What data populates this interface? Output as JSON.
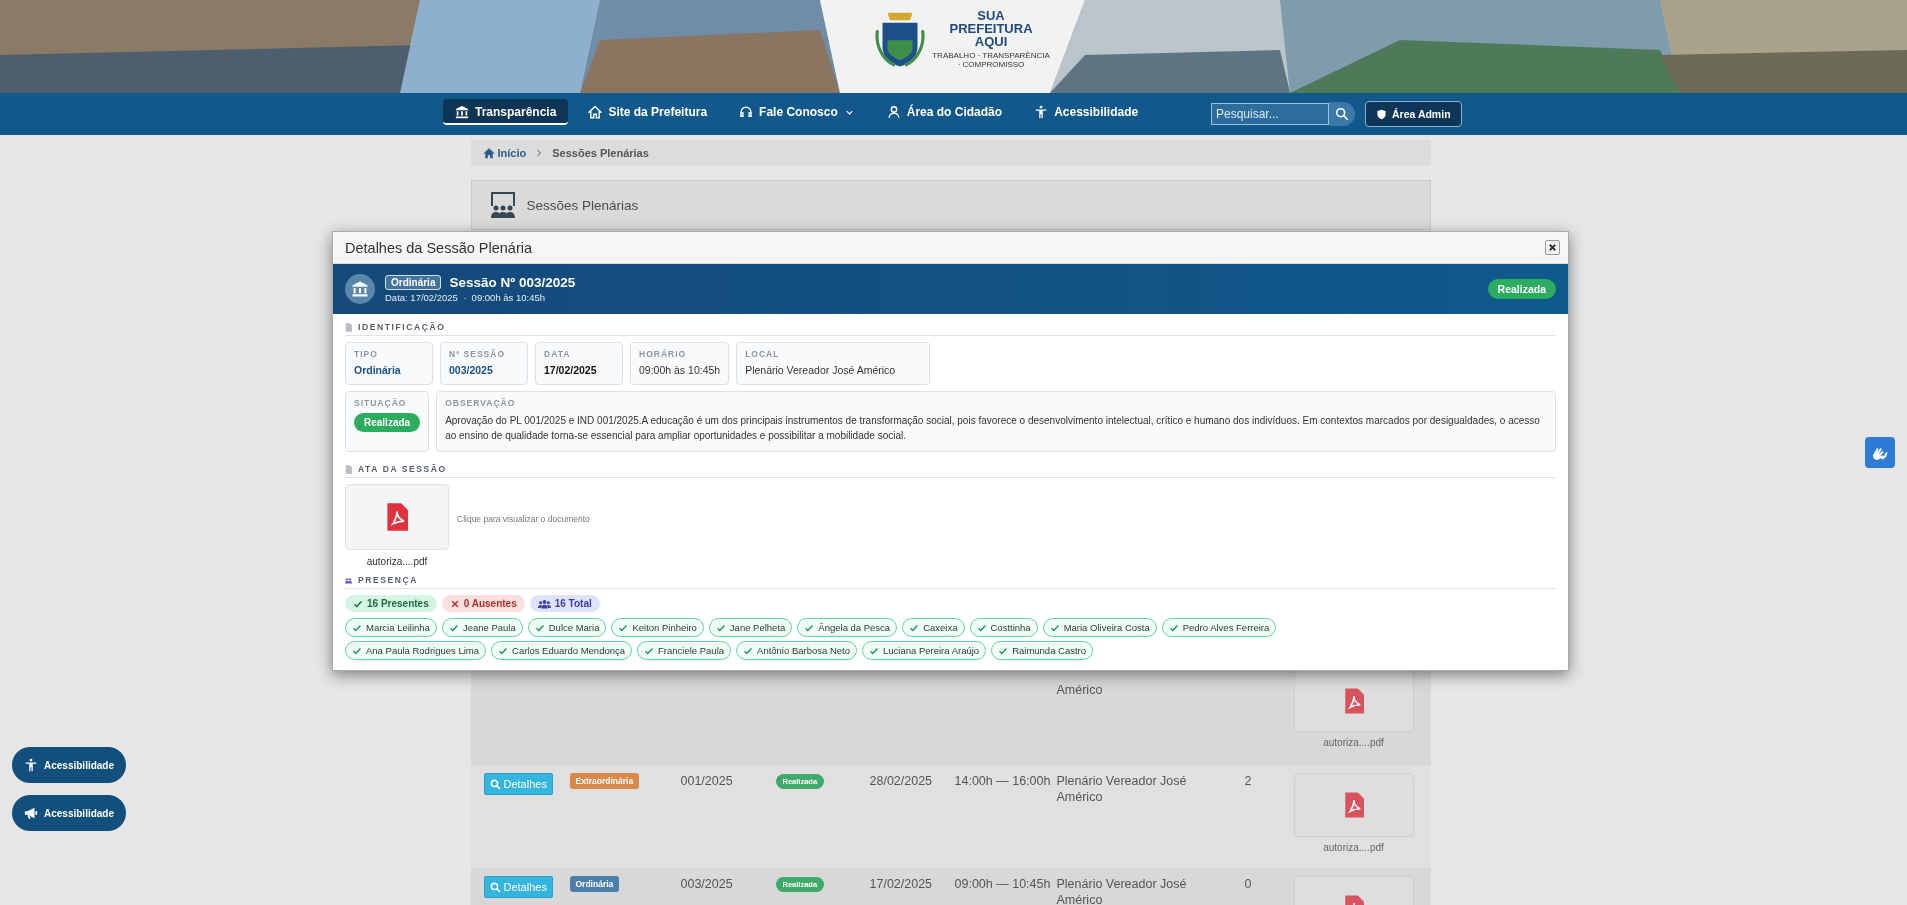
{
  "banner": {
    "logo_lines": [
      "SUA",
      "PREFEITURA",
      "AQUI"
    ],
    "tagline": "TRABALHO · TRANSPARÊNCIA · COMPROMISSO"
  },
  "nav": [
    {
      "label": "Transparência",
      "kind": "bank",
      "selected": true,
      "dropdown": false
    },
    {
      "label": "Site da Prefeitura",
      "kind": "home",
      "selected": false,
      "dropdown": false
    },
    {
      "label": "Fale Conosco",
      "kind": "headset",
      "selected": false,
      "dropdown": true
    },
    {
      "label": "Área do Cidadão",
      "kind": "user",
      "selected": false,
      "dropdown": false
    },
    {
      "label": "Acessibilidade",
      "kind": "accessibility",
      "selected": false,
      "dropdown": false
    }
  ],
  "search": {
    "placeholder": "Pesquisar..."
  },
  "admin_button": "Área Admin",
  "breadcrumb": [
    "Início",
    "Sessões Plenárias"
  ],
  "panel_title": "Sessões Plenárias",
  "table_rows": [
    {
      "kind": "partial",
      "place": "Américo",
      "file": "autoriza....pdf"
    },
    {
      "kind": "full",
      "button": "Detalhes",
      "type": {
        "label": "Extraordinária",
        "kind": "extra"
      },
      "number": "001/2025",
      "status": "Realizada",
      "date": "28/02/2025",
      "time": "14:00h — 16:00h",
      "place": "Plenário Vereador José Américo",
      "count": "2",
      "file": "autoriza....pdf"
    },
    {
      "kind": "full",
      "button": "Detalhes",
      "type": {
        "label": "Ordinária",
        "kind": "ordinary"
      },
      "number": "003/2025",
      "status": "Realizada",
      "date": "17/02/2025",
      "time": "09:00h — 10:45h",
      "place": "Plenário Vereador José Américo",
      "count": "0"
    }
  ],
  "modal": {
    "title": "Detalhes da Sessão Plenária",
    "header": {
      "type": "Ordinária",
      "title": "Sessão Nº 003/2025",
      "subtitle": "Data: 17/02/2025  ·  09:00h às 10:45h",
      "status": "Realizada"
    },
    "identification_heading": "IDENTIFICAÇÃO",
    "fields": [
      {
        "label": "TIPO",
        "value": "Ordinária",
        "kind": "accent"
      },
      {
        "label": "Nº SESSÃO",
        "value": "003/2025",
        "kind": "accent"
      },
      {
        "label": "DATA",
        "value": "17/02/2025",
        "kind": "strong"
      },
      {
        "label": "HORÁRIO",
        "value": "09:00h às 10:45h",
        "kind": "plain"
      },
      {
        "label": "LOCAL",
        "value": "Plenário Vereador José Américo",
        "kind": "plain"
      }
    ],
    "situation": {
      "label": "SITUAÇÃO",
      "value": "Realizada"
    },
    "observation": {
      "label": "OBSERVAÇÃO",
      "value": "Aprovação do PL 001/2025 e IND 001/2025.A educação é um dos principais instrumentos de transformação social, pois favorece o desenvolvimento intelectual, crítico e humano dos indivíduos. Em contextos marcados por desigualdades, o acesso ao ensino de qualidade torna-se essencial para ampliar oportunidades e possibilitar a mobilidade social."
    },
    "minutes_heading": "ATA DA SESSÃO",
    "file": "autoriza....pdf",
    "file_hint": "Clique para visualizar o documento",
    "presence_heading": "PRESENÇA",
    "summary": [
      {
        "label": "16 Presentes",
        "kind": "present"
      },
      {
        "label": "0 Ausentes",
        "kind": "absent"
      },
      {
        "label": "16 Total",
        "kind": "total"
      }
    ],
    "members": [
      "Marcia Leilinha",
      "Jeane Paula",
      "Dulce Maria",
      "Keiton Pinheiro",
      "Jane Pelheta",
      "Ângela da Pesca",
      "Caxeixa",
      "Costtinha",
      "Maria Oliveira Costa",
      "Pedro Alves Ferreira",
      "Ana Paula Rodrigues Lima",
      "Carlos Eduardo Mendonça",
      "Franciele Paula",
      "Antônio Barbosa Neto",
      "Luciana Pereira Araújo",
      "Raimunda Castro"
    ]
  },
  "floating_buttons": [
    {
      "label": "Acessibilidade",
      "kind": "accessibility"
    },
    {
      "label": "Acessibilidade",
      "kind": "megaphone"
    }
  ]
}
